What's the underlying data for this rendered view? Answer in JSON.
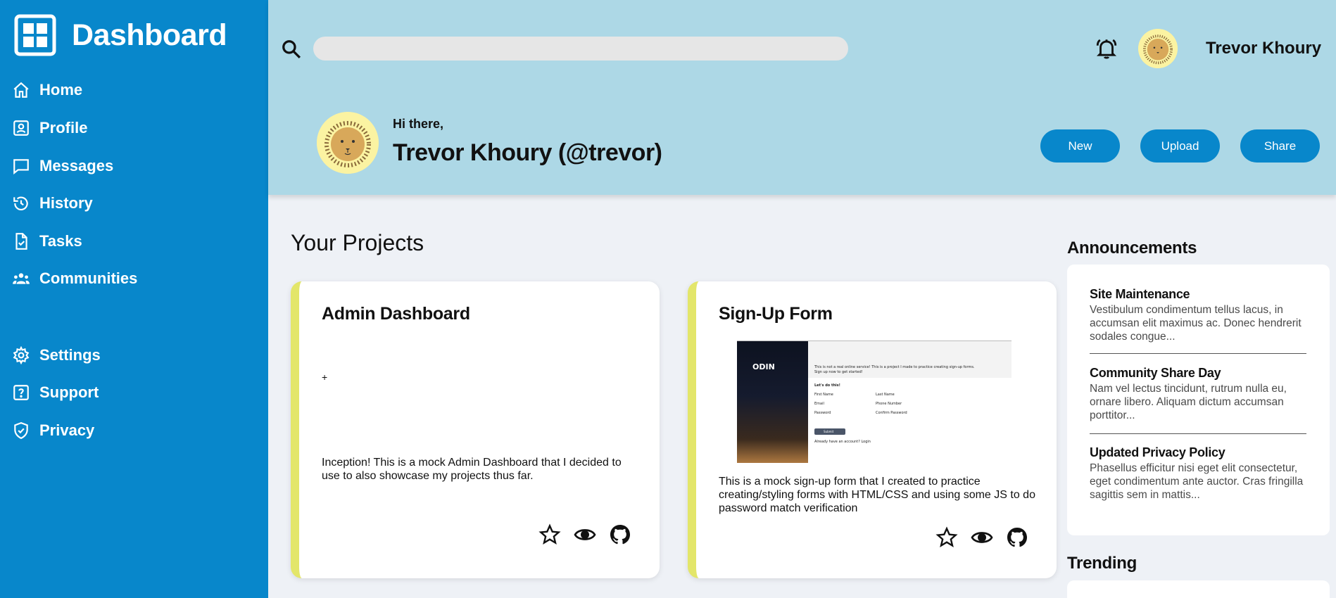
{
  "sidebar": {
    "brand": "Dashboard",
    "nav": [
      {
        "label": "Home",
        "icon": "home-icon"
      },
      {
        "label": "Profile",
        "icon": "profile-icon"
      },
      {
        "label": "Messages",
        "icon": "messages-icon"
      },
      {
        "label": "History",
        "icon": "history-icon"
      },
      {
        "label": "Tasks",
        "icon": "tasks-icon"
      },
      {
        "label": "Communities",
        "icon": "communities-icon"
      }
    ],
    "secondary_nav": [
      {
        "label": "Settings",
        "icon": "settings-icon"
      },
      {
        "label": "Support",
        "icon": "support-icon"
      },
      {
        "label": "Privacy",
        "icon": "privacy-icon"
      }
    ]
  },
  "header": {
    "search": {
      "value": "",
      "placeholder": ""
    },
    "user_name": "Trevor Khoury",
    "greeting": "Hi there,",
    "full_name": "Trevor Khoury (@trevor)",
    "buttons": {
      "new": "New",
      "upload": "Upload",
      "share": "Share"
    }
  },
  "main": {
    "projects_title": "Your Projects",
    "projects": [
      {
        "title": "Admin Dashboard",
        "placeholder": "+",
        "description": "Inception! This is a mock Admin Dashboard that I decided to use to also showcase my projects thus far."
      },
      {
        "title": "Sign-Up Form",
        "description": "This is a mock sign-up form that I created to practice creating/styling forms with HTML/CSS and using some JS to do password match verification",
        "thumbnail": {
          "logo": "ODIN",
          "intro": "This is not a real online service! This is a project I made to practice creating sign-up forms.",
          "cta": "Sign up now to get started!",
          "heading": "Let's do this!",
          "fields": [
            "First Name",
            "Last Name",
            "Email",
            "Phone Number",
            "Password",
            "Confirm Password"
          ],
          "button": "Submit",
          "footer": "Already have an account? Login"
        }
      }
    ]
  },
  "aside": {
    "announcements_title": "Announcements",
    "announcements": [
      {
        "title": "Site Maintenance",
        "body": "Vestibulum condimentum tellus lacus, in accumsan elit maximus ac. Donec hendrerit sodales congue..."
      },
      {
        "title": "Community Share Day",
        "body": "Nam vel lectus tincidunt, rutrum nulla eu, ornare libero. Aliquam dictum accumsan porttitor..."
      },
      {
        "title": "Updated Privacy Policy",
        "body": "Phasellus efficitur nisi eget elit consectetur, eget condimentum ante auctor. Cras fringilla sagittis sem in mattis..."
      }
    ],
    "trending_title": "Trending"
  },
  "colors": {
    "sidebar": "#0887cb",
    "header": "#add8e6",
    "card_accent": "#e3e66a",
    "avatar_bg": "#fbf3a2",
    "background": "#eef1f6"
  }
}
